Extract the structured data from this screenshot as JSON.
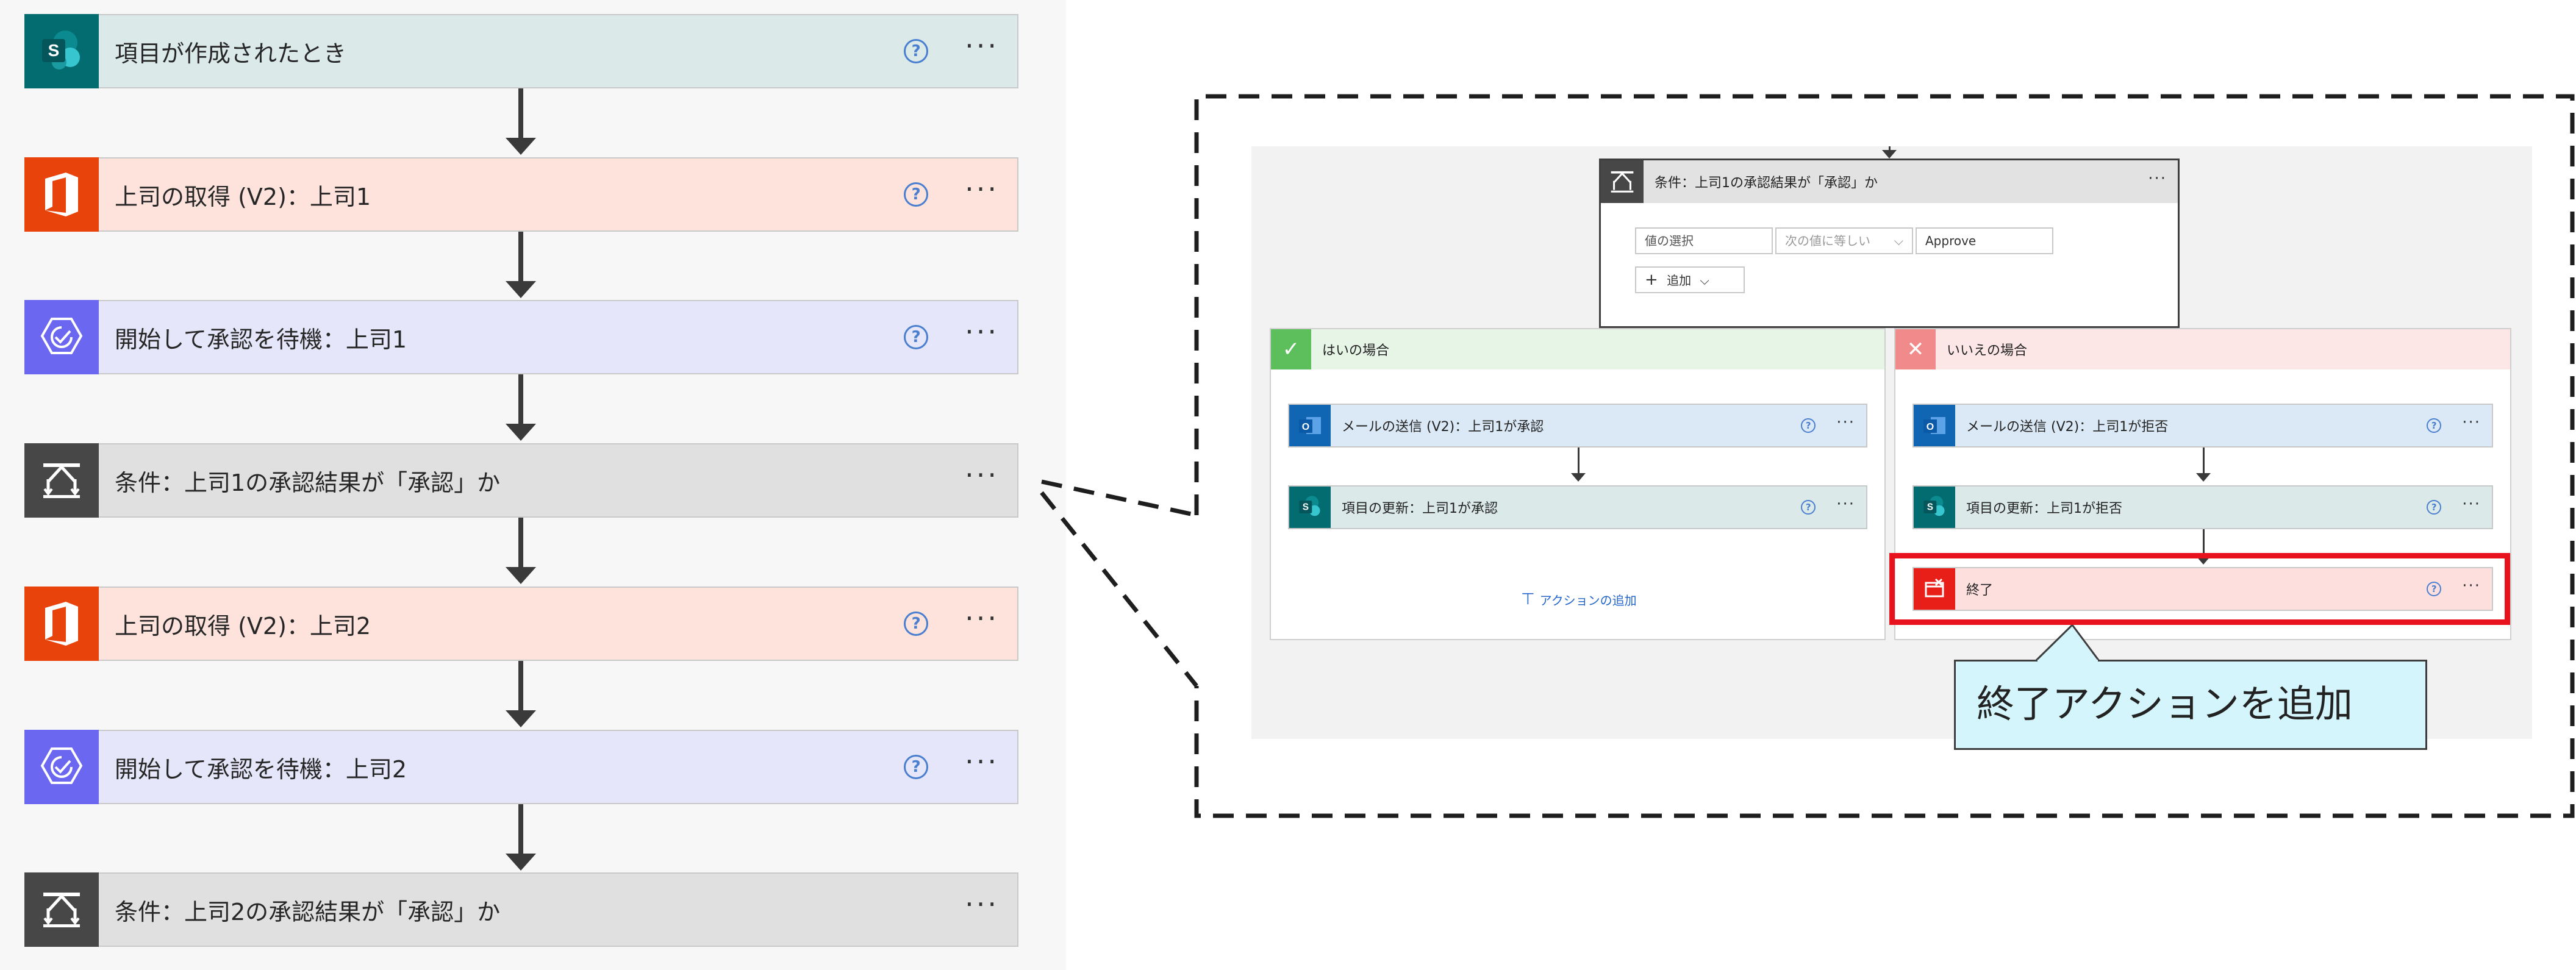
{
  "flow": {
    "steps": [
      {
        "title": "項目が作成されたとき",
        "kind": "sharepoint",
        "help": "?",
        "more": "···"
      },
      {
        "title": "上司の取得 (V2)：上司1",
        "kind": "office365",
        "help": "?",
        "more": "···"
      },
      {
        "title": "開始して承認を待機：上司1",
        "kind": "approval",
        "help": "?",
        "more": "···"
      },
      {
        "title": "条件：上司1の承認結果が「承認」か",
        "kind": "condition",
        "help": "",
        "more": "···"
      },
      {
        "title": "上司の取得 (V2)：上司2",
        "kind": "office365",
        "help": "?",
        "more": "···"
      },
      {
        "title": "開始して承認を待機：上司2",
        "kind": "approval",
        "help": "?",
        "more": "···"
      },
      {
        "title": "条件：上司2の承認結果が「承認」か",
        "kind": "condition",
        "help": "",
        "more": "···"
      }
    ]
  },
  "zoom": {
    "condition": {
      "title": "条件：上司1の承認結果が「承認」か",
      "more": "···",
      "value_placeholder": "値の選択",
      "operator": "次の値に等しい",
      "compare_value": "Approve",
      "add_label": "追加"
    },
    "yes_branch": {
      "title": "はいの場合",
      "steps": [
        {
          "title": "メールの送信 (V2)：上司1が承認",
          "help": "?",
          "more": "···"
        },
        {
          "title": "項目の更新：上司1が承認",
          "help": "?",
          "more": "···"
        }
      ],
      "add_action": "アクションの追加"
    },
    "no_branch": {
      "title": "いいえの場合",
      "steps": [
        {
          "title": "メールの送信 (V2)：上司1が拒否",
          "help": "?",
          "more": "···"
        },
        {
          "title": "項目の更新：上司1が拒否",
          "help": "?",
          "more": "···"
        },
        {
          "title": "終了",
          "help": "?",
          "more": "···"
        }
      ]
    }
  },
  "callout": {
    "text": "終了アクションを追加"
  },
  "colors": {
    "sharepoint": "#036c70",
    "office365": "#e8430b",
    "approval": "#6b67f0",
    "condition": "#474747",
    "highlight": "#e8121e",
    "callout_bg": "#d3f5fb"
  }
}
